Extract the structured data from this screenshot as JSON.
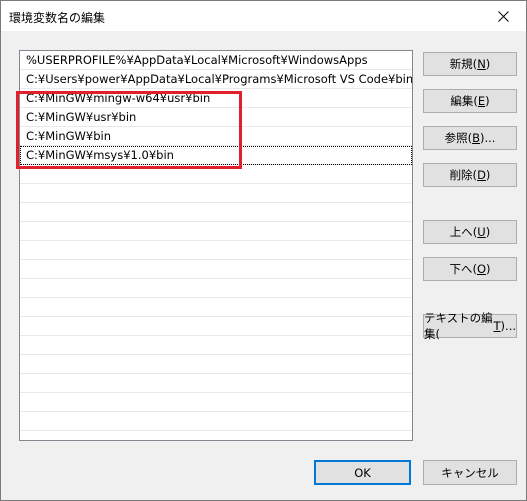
{
  "window": {
    "title": "環境変数名の編集"
  },
  "list": {
    "items": [
      "%USERPROFILE%¥AppData¥Local¥Microsoft¥WindowsApps",
      "C:¥Users¥power¥AppData¥Local¥Programs¥Microsoft VS Code¥bin",
      "C:¥MinGW¥mingw-w64¥usr¥bin",
      "C:¥MinGW¥usr¥bin",
      "C:¥MinGW¥bin",
      "C:¥MinGW¥msys¥1.0¥bin"
    ],
    "focused_index": 5
  },
  "buttons": {
    "new": {
      "label": "新規(",
      "key": "N",
      "end": ")"
    },
    "edit": {
      "label": "編集(",
      "key": "E",
      "end": ")"
    },
    "browse": {
      "label": "参照(",
      "key": "B",
      "end": ")..."
    },
    "delete": {
      "label": "削除(",
      "key": "D",
      "end": ")"
    },
    "up": {
      "label": "上へ(",
      "key": "U",
      "end": ")"
    },
    "down": {
      "label": "下へ(",
      "key": "O",
      "end": ")"
    },
    "edit_text": {
      "label": "テキストの編集(",
      "key": "T",
      "end": ")..."
    },
    "ok": "OK",
    "cancel": "キャンセル"
  },
  "colors": {
    "highlight": "#e0202a",
    "default_button_border": "#0078d7"
  }
}
